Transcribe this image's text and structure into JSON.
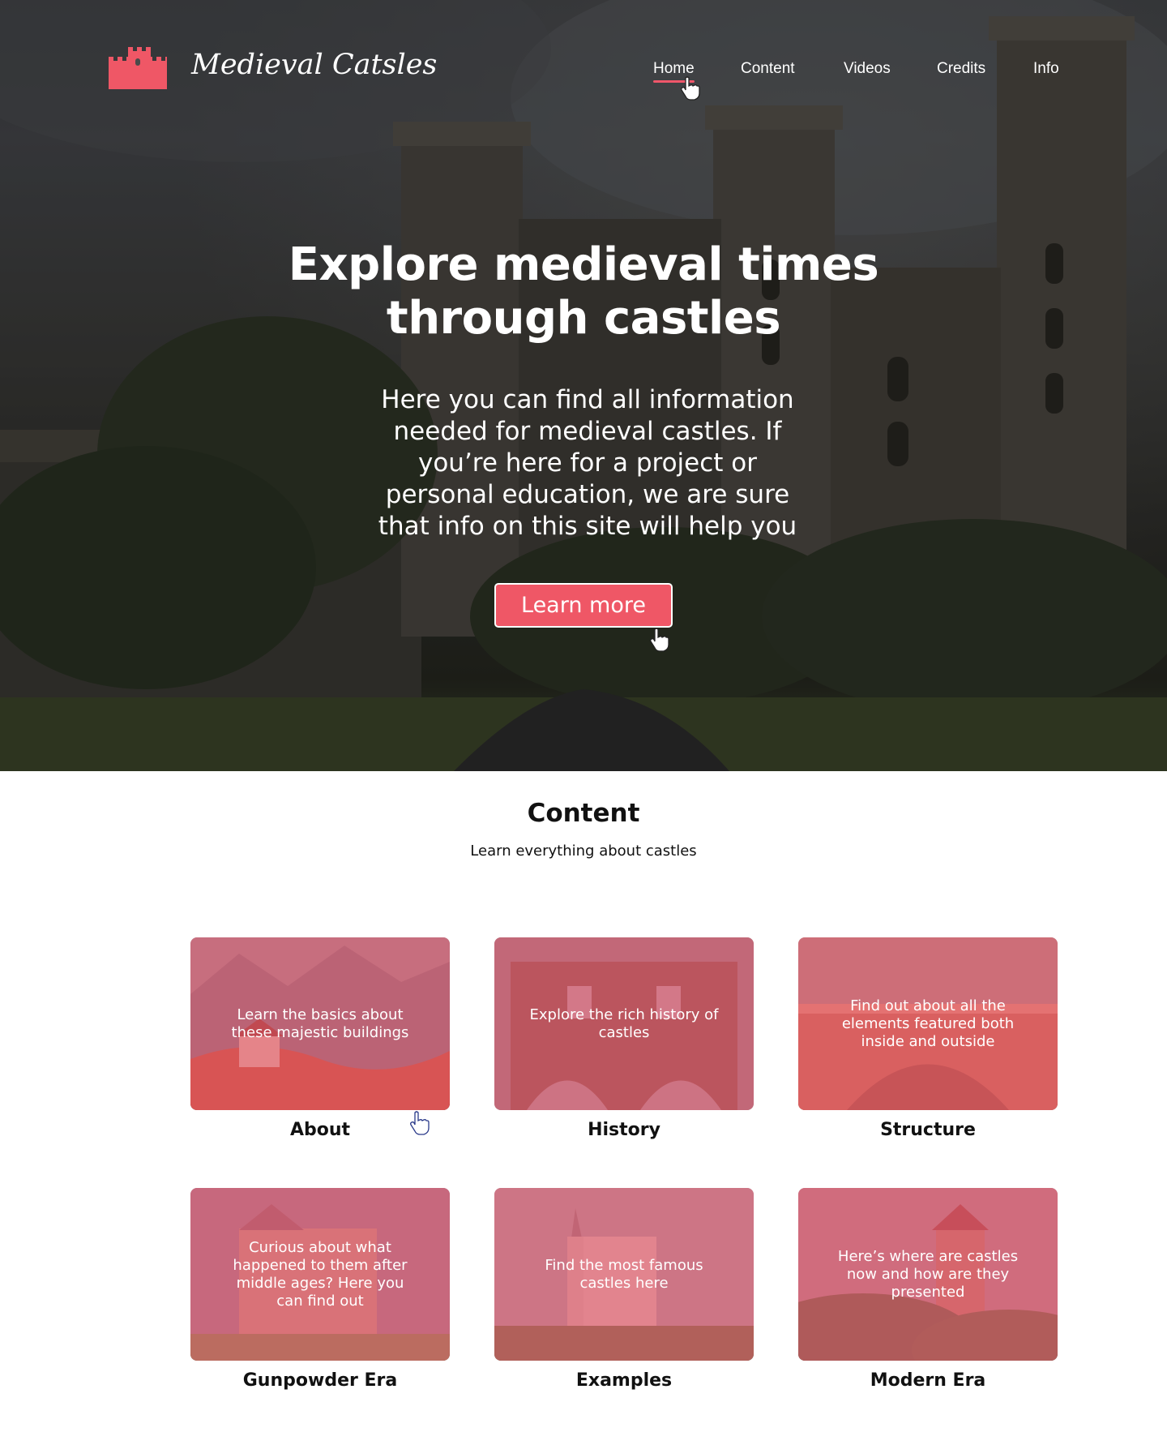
{
  "brand": {
    "name": "Medieval Catsles",
    "logo_icon": "castle-icon",
    "accent": "#ef5766"
  },
  "nav": {
    "items": [
      {
        "label": "Home",
        "active": true
      },
      {
        "label": "Content",
        "active": false
      },
      {
        "label": "Videos",
        "active": false
      },
      {
        "label": "Credits",
        "active": false
      },
      {
        "label": "Info",
        "active": false
      }
    ]
  },
  "hero": {
    "title_line1": "Explore medieval times",
    "title_line2": "through castles",
    "subtitle": "Here you can find all information needed for medieval castles. If you’re here for a project or personal education, we are sure that info on this site will help you",
    "cta_label": "Learn more"
  },
  "content": {
    "title": "Content",
    "subtitle": "Learn everything about castles",
    "cards": [
      {
        "label": "About",
        "text": "Learn the basics about these majestic buildings"
      },
      {
        "label": "History",
        "text": "Explore the rich history of castles"
      },
      {
        "label": "Structure",
        "text": "Find out about all the elements featured both inside and outside"
      },
      {
        "label": "Gunpowder Era",
        "text": "Curious about what happened to them after middle ages? Here you can find out"
      },
      {
        "label": "Examples",
        "text": "Find the most famous castles here"
      },
      {
        "label": "Modern Era",
        "text": "Here’s where are castles now and how are they presented"
      }
    ]
  }
}
